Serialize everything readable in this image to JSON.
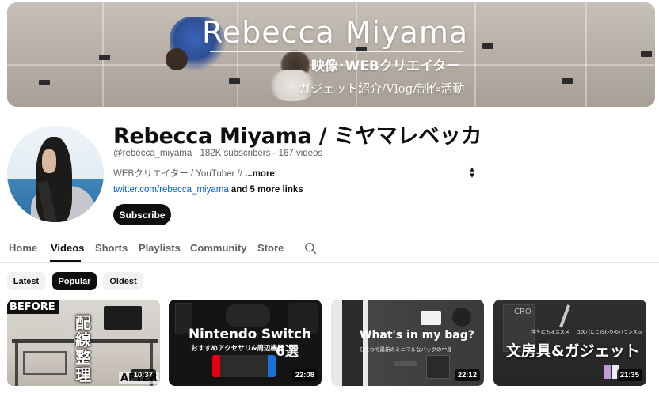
{
  "banner": {
    "title": "Rebecca Miyama",
    "subtitle": "映像･WEBクリエイター",
    "tagline": "ガジェット紹介/Vlog/制作活動"
  },
  "channel": {
    "name": "Rebecca Miyama / ミヤマレベッカ",
    "handle": "@rebecca_miyama",
    "subscribers": "182K subscribers",
    "videos": "167 videos",
    "description": "WEBクリエイター / YouTuber // ",
    "more_label": "...more",
    "link_url": "twitter.com/rebecca_miyama",
    "more_links": "and 5 more links",
    "subscribe_label": "Subscribe"
  },
  "tabs": [
    {
      "label": "Home"
    },
    {
      "label": "Videos",
      "active": true
    },
    {
      "label": "Shorts"
    },
    {
      "label": "Playlists"
    },
    {
      "label": "Community"
    },
    {
      "label": "Store"
    }
  ],
  "chips": [
    {
      "label": "Latest"
    },
    {
      "label": "Popular",
      "active": true
    },
    {
      "label": "Oldest"
    }
  ],
  "videos": [
    {
      "duration": "10:37",
      "thumb_text": {
        "before": "BEFORE",
        "after": "AFTER",
        "jp": "配線整理"
      }
    },
    {
      "duration": "22:08",
      "thumb_text": {
        "title": "Nintendo Switch",
        "subtitle": "おすすめアクセサリ&周辺機器",
        "count": "6選"
      }
    },
    {
      "duration": "22:12",
      "thumb_text": {
        "title": "What's in my bag?",
        "subtitle": "ひとつで最新のミニマルなバッグの中身"
      }
    },
    {
      "duration": "21:35",
      "thumb_text": {
        "book": "CRO",
        "tag1": "学生にもオススメ",
        "tag2": "コスパとこだわりのバランス◎",
        "title": "文房具&ガジェット"
      }
    }
  ],
  "colors": {
    "link": "#065fd4",
    "primary": "#0f0f0f",
    "secondary_text": "#606060",
    "chip_bg": "#f2f2f2"
  },
  "icons": {
    "search": "search-icon",
    "sort": "sort-arrows-icon"
  }
}
